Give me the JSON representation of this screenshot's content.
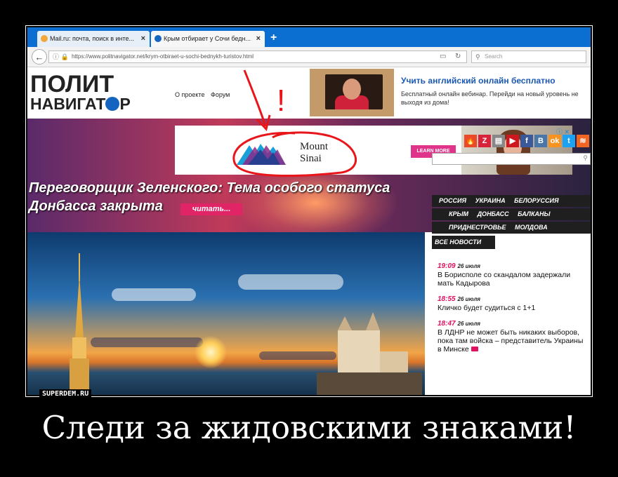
{
  "browser": {
    "tabs": [
      {
        "label": "Mail.ru: почта, поиск в инте..."
      },
      {
        "label": "Крым отбирает у Сочи бедн..."
      }
    ],
    "new_tab": "+",
    "url": "https://www.politnavigator.net/krym-otbiraet-u-sochi-bednykh-turistov.html",
    "search_placeholder": "Search"
  },
  "site": {
    "logo_line1": "ПОЛИТ",
    "logo_line2": "НАВИГАТ",
    "logo_line2_end": "Р",
    "nav": [
      "О проекте",
      "Форум"
    ]
  },
  "top_ad": {
    "title": "Учить английский онлайн бесплатно",
    "text": "Бесплатный онлайн вебинар. Перейди на новый уровень не выходя из дома!"
  },
  "banner_ad": {
    "brand_line1": "Mount",
    "brand_line2": "Sinai",
    "cta": "LEARN MORE",
    "adchoices": "ⓘ ✕"
  },
  "headline": {
    "line1": "Переговорщик Зеленского: Тема особого статуса",
    "line2": "Донбасса закрыта",
    "read_more": "читать..."
  },
  "social_icons": [
    "fire-icon",
    "zen-icon",
    "news-icon",
    "youtube-icon",
    "facebook-icon",
    "vk-icon",
    "odnoklassniki-icon",
    "twitter-icon",
    "rss-icon",
    "telegram-icon"
  ],
  "social_glyphs": [
    "🔥",
    "Z",
    "▤",
    "▶",
    "f",
    "В",
    "ok",
    "t",
    "≋",
    "➤"
  ],
  "social_colors": [
    "#e84a2a",
    "#d8233a",
    "#888888",
    "#cc181e",
    "#3b5998",
    "#4a76a8",
    "#f7931e",
    "#1da1f2",
    "#f26522",
    "#2aa3e0"
  ],
  "rubrics": {
    "row1": [
      "РОССИЯ",
      "УКРАИНА",
      "БЕЛОРУССИЯ"
    ],
    "row2": [
      "КРЫМ",
      "ДОНБАСС",
      "БАЛКАНЫ"
    ],
    "row3": [
      "ПРИДНЕСТРОВЬЕ",
      "МОЛДОВА"
    ]
  },
  "news": {
    "tab": "ВСЕ НОВОСТИ",
    "items": [
      {
        "time": "19:09",
        "date": "26 июля",
        "text": "В Борисполе со скандалом задержали мать Кадырова"
      },
      {
        "time": "18:55",
        "date": "26 июля",
        "text": "Кличко будет судиться с 1+1"
      },
      {
        "time": "18:47",
        "date": "26 июля",
        "text": "В ЛДНР не может быть никаких выборов, пока там войска – представитель Украины в Минске"
      }
    ]
  },
  "annotation": {
    "mark": "!"
  },
  "demotivator": {
    "watermark": "SUPERDEM.RU",
    "caption": "Следи за жидовскими знаками!"
  }
}
